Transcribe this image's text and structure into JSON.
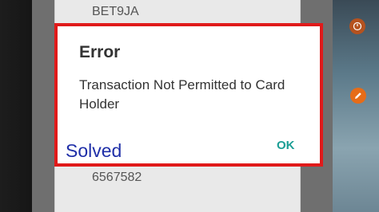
{
  "background_app": {
    "top_text": "BET9JA",
    "bottom_text": "6567582"
  },
  "dialog": {
    "title": "Error",
    "message": "Transaction Not Permitted to Card Holder",
    "ok_label": "OK",
    "overlay_caption": "Solved"
  },
  "colors": {
    "dialog_border": "#e01a1a",
    "ok_text": "#1b9e95",
    "overlay_caption": "#1f2fa8",
    "floating_buttons": "#e66c18"
  },
  "floating_icons": [
    "timer-icon",
    "edit-pencil-icon"
  ]
}
